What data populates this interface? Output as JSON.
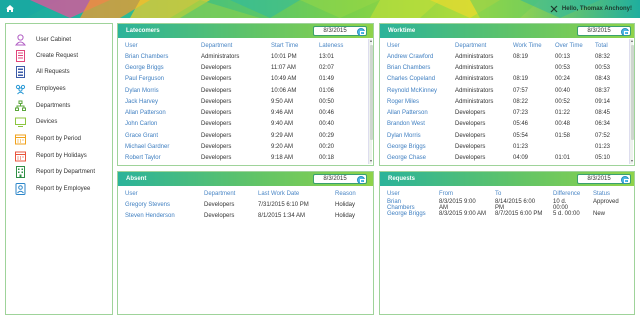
{
  "header": {
    "greeting": "Hello, Thomax Anchony!"
  },
  "sidebar": {
    "items": [
      {
        "label": "User Cabinet",
        "icon": "user-icon",
        "color": "#b25fc4"
      },
      {
        "label": "Create Request",
        "icon": "form-icon",
        "color": "#e0457b"
      },
      {
        "label": "All Requests",
        "icon": "list-icon",
        "color": "#3d5ca8"
      },
      {
        "label": "Employees",
        "icon": "group-icon",
        "color": "#2e9bd6"
      },
      {
        "label": "Departments",
        "icon": "org-chart-icon",
        "color": "#5aa63a"
      },
      {
        "label": "Devices",
        "icon": "monitor-icon",
        "color": "#8cc63f"
      },
      {
        "label": "Report by Period",
        "icon": "calendar-icon",
        "color": "#f0a21b"
      },
      {
        "label": "Report by Holidays",
        "icon": "calendar-icon",
        "color": "#e8543c"
      },
      {
        "label": "Report by Department",
        "icon": "building-icon",
        "color": "#2f8f46"
      },
      {
        "label": "Report by Employee",
        "icon": "id-badge-icon",
        "color": "#2c86c9"
      }
    ]
  },
  "latecomers": {
    "title": "Latecomers",
    "date": "8/3/2015",
    "columns": [
      "User",
      "Department",
      "Start Time",
      "Lateness"
    ],
    "rows": [
      [
        "Brian Chambers",
        "Administrators",
        "10:01 PM",
        "13:01"
      ],
      [
        "George Briggs",
        "Developers",
        "11:07 AM",
        "02:07"
      ],
      [
        "Paul Ferguson",
        "Developers",
        "10:49 AM",
        "01:49"
      ],
      [
        "Dylan Morris",
        "Developers",
        "10:06 AM",
        "01:06"
      ],
      [
        "Jack Harvey",
        "Developers",
        "9:50 AM",
        "00:50"
      ],
      [
        "Allan Patterson",
        "Developers",
        "9:46 AM",
        "00:46"
      ],
      [
        "John Carlon",
        "Developers",
        "9:40 AM",
        "00:40"
      ],
      [
        "Grace Grant",
        "Developers",
        "9:29 AM",
        "00:29"
      ],
      [
        "Michael Gardner",
        "Developers",
        "9:20 AM",
        "00:20"
      ],
      [
        "Robert Taylor",
        "Developers",
        "9:18 AM",
        "00:18"
      ]
    ]
  },
  "worktime": {
    "title": "Worktime",
    "date": "8/3/2015",
    "columns": [
      "User",
      "Department",
      "Work Time",
      "Over Time",
      "Total"
    ],
    "rows": [
      [
        "Andrew Crawford",
        "Administrators",
        "08:19",
        "00:13",
        "08:32"
      ],
      [
        "Brian Chambers",
        "Administrators",
        "",
        "00:53",
        "00:53"
      ],
      [
        "Charles Copeland",
        "Administrators",
        "08:19",
        "00:24",
        "08:43"
      ],
      [
        "Reynold McKinney",
        "Administrators",
        "07:57",
        "00:40",
        "08:37"
      ],
      [
        "Roger Miles",
        "Administrators",
        "08:22",
        "00:52",
        "09:14"
      ],
      [
        "Allan Patterson",
        "Developers",
        "07:23",
        "01:22",
        "08:45"
      ],
      [
        "Brandon West",
        "Developers",
        "05:46",
        "00:48",
        "06:34"
      ],
      [
        "Dylan Morris",
        "Developers",
        "05:54",
        "01:58",
        "07:52"
      ],
      [
        "George Briggs",
        "Developers",
        "01:23",
        "",
        "01:23"
      ],
      [
        "George Chase",
        "Developers",
        "04:09",
        "01:01",
        "05:10"
      ]
    ]
  },
  "absent": {
    "title": "Absent",
    "date": "8/3/2015",
    "columns": [
      "User",
      "Department",
      "Last Work Date",
      "Reason"
    ],
    "rows": [
      [
        "Gregory Stevens",
        "Developers",
        "7/31/2015 6:10 PM",
        "Holiday"
      ],
      [
        "Steven Henderson",
        "Developers",
        "8/1/2015 1:34 AM",
        "Holiday"
      ]
    ]
  },
  "requests": {
    "title": "Requests",
    "date": "8/3/2015",
    "columns": [
      "User",
      "From",
      "To",
      "Difference",
      "Status"
    ],
    "rows": [
      [
        [
          "Brian",
          "Chambers"
        ],
        [
          "8/3/2015 9:00",
          "AM"
        ],
        [
          "8/14/2015 6:00",
          "PM"
        ],
        [
          "10 d.",
          "00:00"
        ],
        [
          "Approved",
          ""
        ]
      ],
      [
        [
          "George Briggs",
          ""
        ],
        [
          "8/3/2015 9:00 AM",
          ""
        ],
        [
          "8/7/2015 6:00 PM",
          ""
        ],
        [
          "5 d. 00:00",
          ""
        ],
        [
          "New",
          ""
        ]
      ]
    ]
  }
}
